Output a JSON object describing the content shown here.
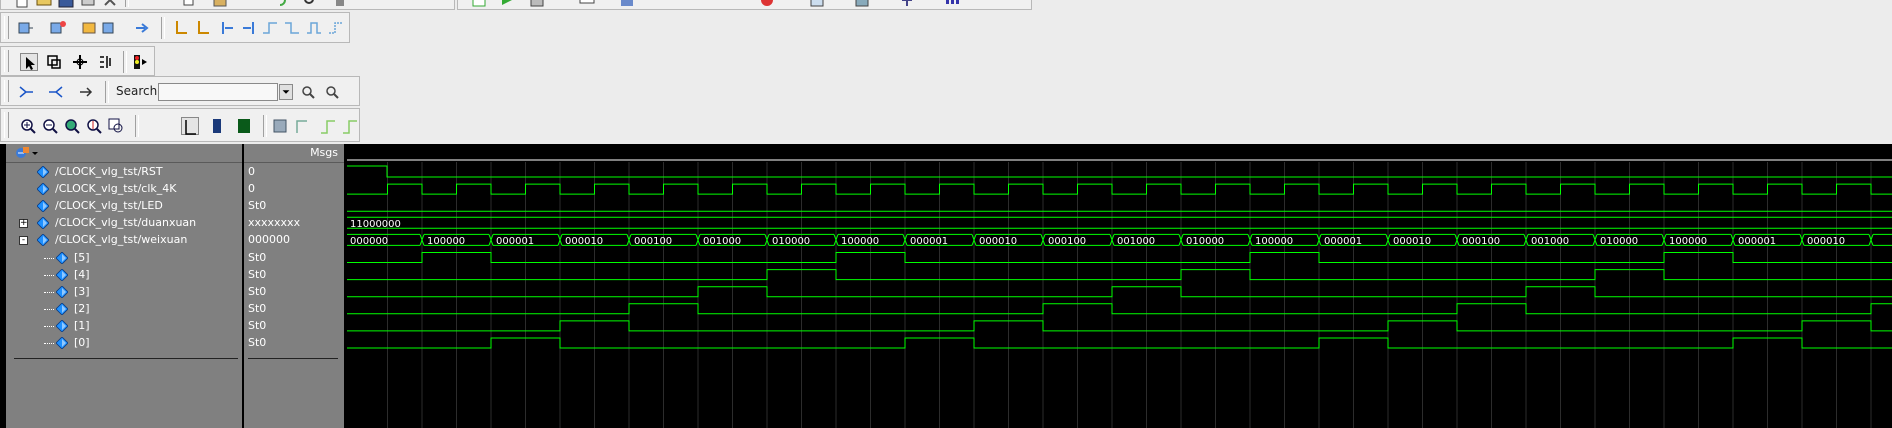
{
  "toolbar": {
    "search_label": "Search:",
    "search_value": ""
  },
  "wave": {
    "msgs_header": "Msgs",
    "signals": [
      {
        "name": "/CLOCK_vlg_tst/RST",
        "value": "0"
      },
      {
        "name": "/CLOCK_vlg_tst/clk_4K",
        "value": "0"
      },
      {
        "name": "/CLOCK_vlg_tst/LED",
        "value": "St0"
      },
      {
        "name": "/CLOCK_vlg_tst/duanxuan",
        "value": "xxxxxxxx",
        "expander": "+"
      },
      {
        "name": "/CLOCK_vlg_tst/weixuan",
        "value": "000000",
        "expander": "-"
      },
      {
        "name": "[5]",
        "value": "St0"
      },
      {
        "name": "[4]",
        "value": "St0"
      },
      {
        "name": "[3]",
        "value": "St0"
      },
      {
        "name": "[2]",
        "value": "St0"
      },
      {
        "name": "[1]",
        "value": "St0"
      },
      {
        "name": "[0]",
        "value": "St0"
      }
    ],
    "duanxuan_bus_label": "11000000",
    "weixuan_bus_labels": [
      "000000",
      "100000",
      "000001",
      "000010",
      "000100",
      "001000",
      "010000",
      "100000",
      "000001",
      "000010",
      "000100",
      "001000",
      "010000",
      "100000",
      "000001",
      "000010",
      "000100",
      "001000",
      "010000",
      "100000",
      "000001",
      "000010"
    ],
    "colors": {
      "wave": "#00ff00",
      "value_text": "#ffffff",
      "pane": "#808080",
      "background": "#000000",
      "diamond": "#1e90ff"
    }
  }
}
